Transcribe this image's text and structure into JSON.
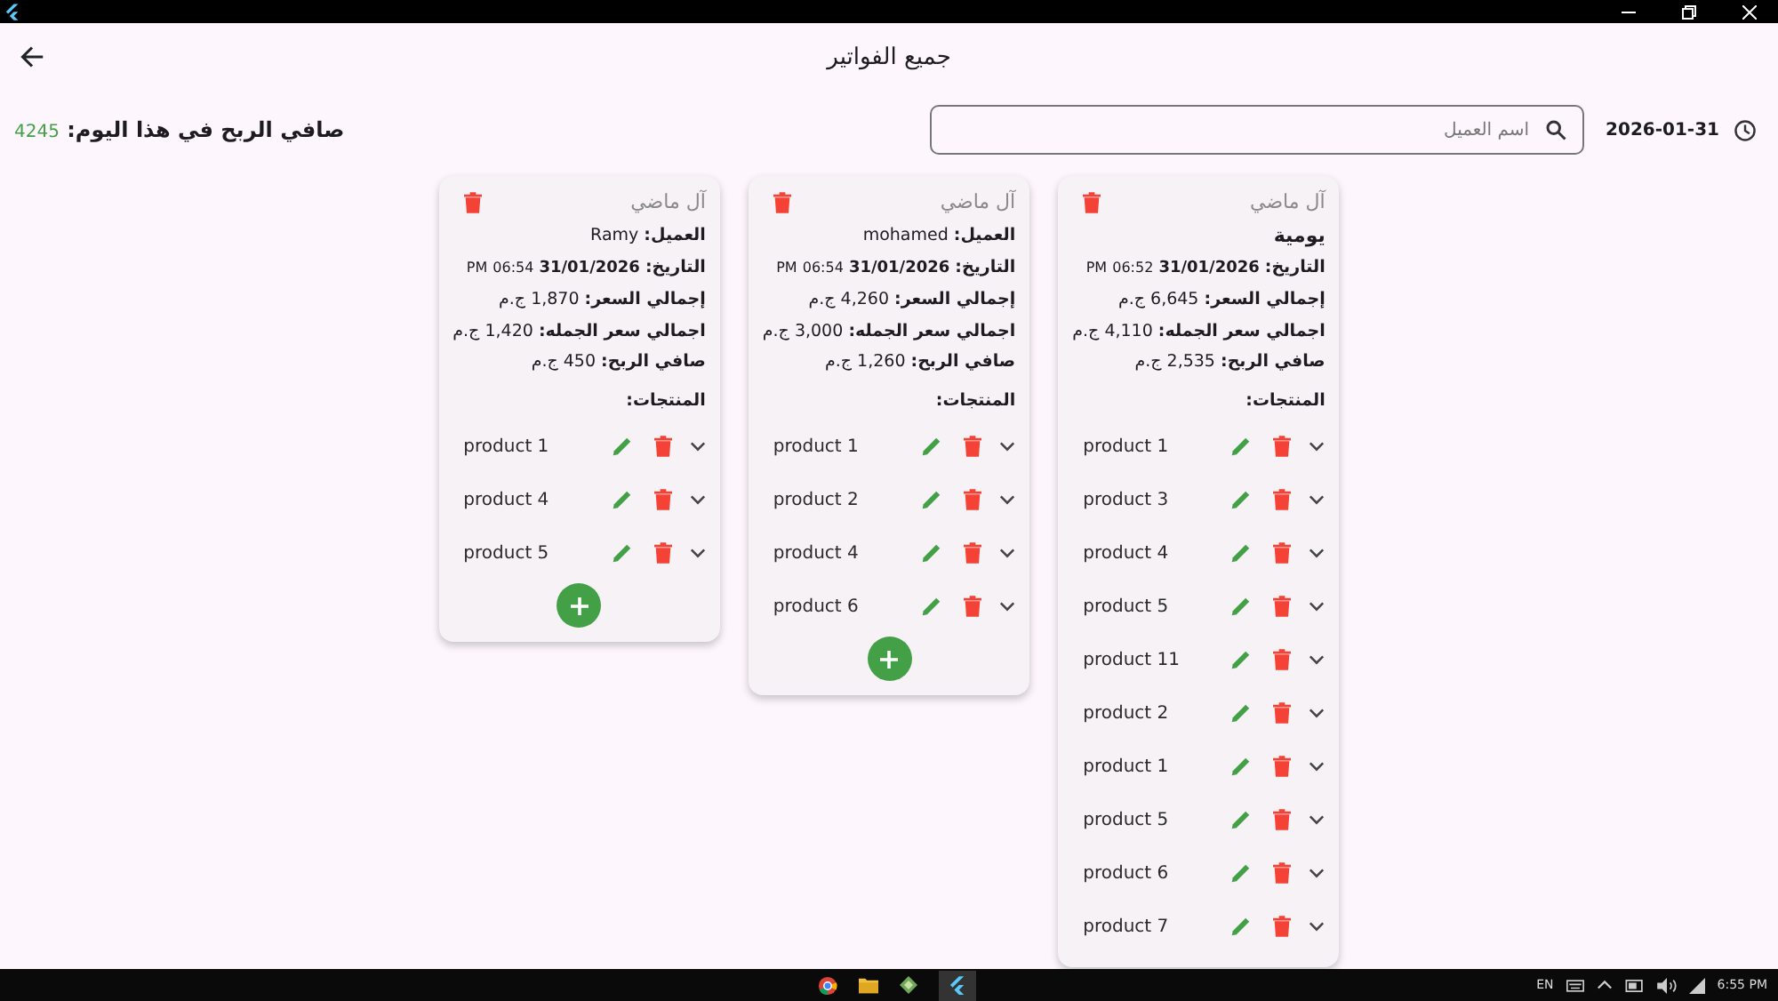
{
  "app_bar": {
    "title": "جميع الفواتير"
  },
  "summary": {
    "date": "2026-01-31",
    "search": {
      "placeholder": "اسم العميل"
    },
    "profit_label": "صافي الربح في هذا اليوم:",
    "profit_value": "4245"
  },
  "invoices": [
    {
      "shop": "آل ماضي",
      "customer": "يومية",
      "date_label": "التاريخ:",
      "date": "31/01/2026",
      "time": "06:52",
      "period": "PM",
      "total_label": "إجمالي السعر:",
      "total": "6,645 ج.م",
      "wholesale_label": "اجمالي سعر الجمله:",
      "wholesale": "4,110 ج.م",
      "profit_label": "صافي الربح:",
      "profit": "2,535 ج.م",
      "products_label": "المنتجات:",
      "products": [
        "product 1",
        "product 3",
        "product 4",
        "product 5",
        "product 11",
        "product 2",
        "product 1",
        "product 5",
        "product 6",
        "product 7"
      ]
    },
    {
      "shop": "آل ماضي",
      "customer_label": "العميل:",
      "customer": "mohamed",
      "date_label": "التاريخ:",
      "date": "31/01/2026",
      "time": "06:54",
      "period": "PM",
      "total_label": "إجمالي السعر:",
      "total": "4,260 ج.م",
      "wholesale_label": "اجمالي سعر الجمله:",
      "wholesale": "3,000 ج.م",
      "profit_label": "صافي الربح:",
      "profit": "1,260 ج.م",
      "products_label": "المنتجات:",
      "products": [
        "product 1",
        "product 2",
        "product 4",
        "product 6"
      ],
      "add_button": true
    },
    {
      "shop": "آل ماضي",
      "customer_label": "العميل:",
      "customer": "Ramy",
      "date_label": "التاريخ:",
      "date": "31/01/2026",
      "time": "06:54",
      "period": "PM",
      "total_label": "إجمالي السعر:",
      "total": "1,870 ج.م",
      "wholesale_label": "اجمالي سعر الجمله:",
      "wholesale": "1,420 ج.م",
      "profit_label": "صافي الربح:",
      "profit": "450 ج.م",
      "products_label": "المنتجات:",
      "products": [
        "product 1",
        "product 4",
        "product 5"
      ],
      "add_button": true
    }
  ],
  "taskbar": {
    "language": "EN",
    "time": "6:55 PM"
  }
}
